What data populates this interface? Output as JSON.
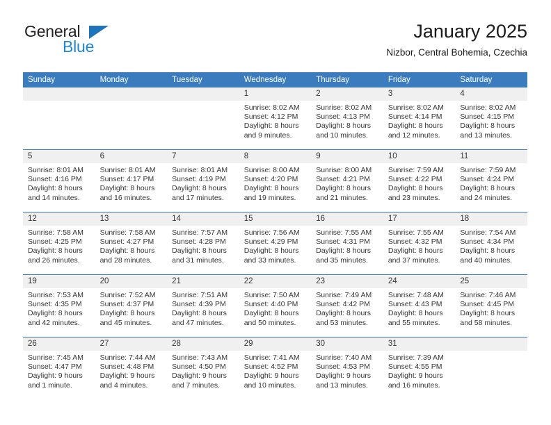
{
  "brand": {
    "name_top": "General",
    "name_bottom": "Blue",
    "triangle_color": "#1e74bb",
    "blue_text_color": "#1e87d6"
  },
  "header": {
    "title": "January 2025",
    "subtitle": "Nizbor, Central Bohemia, Czechia"
  },
  "theme": {
    "header_bg": "#3a7cbe",
    "header_text": "#ffffff",
    "daynum_bg": "#f0f0f0",
    "text": "#333333",
    "row_divider": "#3a7cbe"
  },
  "weekdays": [
    "Sunday",
    "Monday",
    "Tuesday",
    "Wednesday",
    "Thursday",
    "Friday",
    "Saturday"
  ],
  "weeks": [
    [
      {
        "day": "",
        "lines": []
      },
      {
        "day": "",
        "lines": []
      },
      {
        "day": "",
        "lines": []
      },
      {
        "day": "1",
        "lines": [
          "Sunrise: 8:02 AM",
          "Sunset: 4:12 PM",
          "Daylight: 8 hours",
          "and 9 minutes."
        ]
      },
      {
        "day": "2",
        "lines": [
          "Sunrise: 8:02 AM",
          "Sunset: 4:13 PM",
          "Daylight: 8 hours",
          "and 10 minutes."
        ]
      },
      {
        "day": "3",
        "lines": [
          "Sunrise: 8:02 AM",
          "Sunset: 4:14 PM",
          "Daylight: 8 hours",
          "and 12 minutes."
        ]
      },
      {
        "day": "4",
        "lines": [
          "Sunrise: 8:02 AM",
          "Sunset: 4:15 PM",
          "Daylight: 8 hours",
          "and 13 minutes."
        ]
      }
    ],
    [
      {
        "day": "5",
        "lines": [
          "Sunrise: 8:01 AM",
          "Sunset: 4:16 PM",
          "Daylight: 8 hours",
          "and 14 minutes."
        ]
      },
      {
        "day": "6",
        "lines": [
          "Sunrise: 8:01 AM",
          "Sunset: 4:17 PM",
          "Daylight: 8 hours",
          "and 16 minutes."
        ]
      },
      {
        "day": "7",
        "lines": [
          "Sunrise: 8:01 AM",
          "Sunset: 4:19 PM",
          "Daylight: 8 hours",
          "and 17 minutes."
        ]
      },
      {
        "day": "8",
        "lines": [
          "Sunrise: 8:00 AM",
          "Sunset: 4:20 PM",
          "Daylight: 8 hours",
          "and 19 minutes."
        ]
      },
      {
        "day": "9",
        "lines": [
          "Sunrise: 8:00 AM",
          "Sunset: 4:21 PM",
          "Daylight: 8 hours",
          "and 21 minutes."
        ]
      },
      {
        "day": "10",
        "lines": [
          "Sunrise: 7:59 AM",
          "Sunset: 4:22 PM",
          "Daylight: 8 hours",
          "and 23 minutes."
        ]
      },
      {
        "day": "11",
        "lines": [
          "Sunrise: 7:59 AM",
          "Sunset: 4:24 PM",
          "Daylight: 8 hours",
          "and 24 minutes."
        ]
      }
    ],
    [
      {
        "day": "12",
        "lines": [
          "Sunrise: 7:58 AM",
          "Sunset: 4:25 PM",
          "Daylight: 8 hours",
          "and 26 minutes."
        ]
      },
      {
        "day": "13",
        "lines": [
          "Sunrise: 7:58 AM",
          "Sunset: 4:27 PM",
          "Daylight: 8 hours",
          "and 28 minutes."
        ]
      },
      {
        "day": "14",
        "lines": [
          "Sunrise: 7:57 AM",
          "Sunset: 4:28 PM",
          "Daylight: 8 hours",
          "and 31 minutes."
        ]
      },
      {
        "day": "15",
        "lines": [
          "Sunrise: 7:56 AM",
          "Sunset: 4:29 PM",
          "Daylight: 8 hours",
          "and 33 minutes."
        ]
      },
      {
        "day": "16",
        "lines": [
          "Sunrise: 7:55 AM",
          "Sunset: 4:31 PM",
          "Daylight: 8 hours",
          "and 35 minutes."
        ]
      },
      {
        "day": "17",
        "lines": [
          "Sunrise: 7:55 AM",
          "Sunset: 4:32 PM",
          "Daylight: 8 hours",
          "and 37 minutes."
        ]
      },
      {
        "day": "18",
        "lines": [
          "Sunrise: 7:54 AM",
          "Sunset: 4:34 PM",
          "Daylight: 8 hours",
          "and 40 minutes."
        ]
      }
    ],
    [
      {
        "day": "19",
        "lines": [
          "Sunrise: 7:53 AM",
          "Sunset: 4:35 PM",
          "Daylight: 8 hours",
          "and 42 minutes."
        ]
      },
      {
        "day": "20",
        "lines": [
          "Sunrise: 7:52 AM",
          "Sunset: 4:37 PM",
          "Daylight: 8 hours",
          "and 45 minutes."
        ]
      },
      {
        "day": "21",
        "lines": [
          "Sunrise: 7:51 AM",
          "Sunset: 4:39 PM",
          "Daylight: 8 hours",
          "and 47 minutes."
        ]
      },
      {
        "day": "22",
        "lines": [
          "Sunrise: 7:50 AM",
          "Sunset: 4:40 PM",
          "Daylight: 8 hours",
          "and 50 minutes."
        ]
      },
      {
        "day": "23",
        "lines": [
          "Sunrise: 7:49 AM",
          "Sunset: 4:42 PM",
          "Daylight: 8 hours",
          "and 53 minutes."
        ]
      },
      {
        "day": "24",
        "lines": [
          "Sunrise: 7:48 AM",
          "Sunset: 4:43 PM",
          "Daylight: 8 hours",
          "and 55 minutes."
        ]
      },
      {
        "day": "25",
        "lines": [
          "Sunrise: 7:46 AM",
          "Sunset: 4:45 PM",
          "Daylight: 8 hours",
          "and 58 minutes."
        ]
      }
    ],
    [
      {
        "day": "26",
        "lines": [
          "Sunrise: 7:45 AM",
          "Sunset: 4:47 PM",
          "Daylight: 9 hours",
          "and 1 minute."
        ]
      },
      {
        "day": "27",
        "lines": [
          "Sunrise: 7:44 AM",
          "Sunset: 4:48 PM",
          "Daylight: 9 hours",
          "and 4 minutes."
        ]
      },
      {
        "day": "28",
        "lines": [
          "Sunrise: 7:43 AM",
          "Sunset: 4:50 PM",
          "Daylight: 9 hours",
          "and 7 minutes."
        ]
      },
      {
        "day": "29",
        "lines": [
          "Sunrise: 7:41 AM",
          "Sunset: 4:52 PM",
          "Daylight: 9 hours",
          "and 10 minutes."
        ]
      },
      {
        "day": "30",
        "lines": [
          "Sunrise: 7:40 AM",
          "Sunset: 4:53 PM",
          "Daylight: 9 hours",
          "and 13 minutes."
        ]
      },
      {
        "day": "31",
        "lines": [
          "Sunrise: 7:39 AM",
          "Sunset: 4:55 PM",
          "Daylight: 9 hours",
          "and 16 minutes."
        ]
      },
      {
        "day": "",
        "lines": []
      }
    ]
  ]
}
